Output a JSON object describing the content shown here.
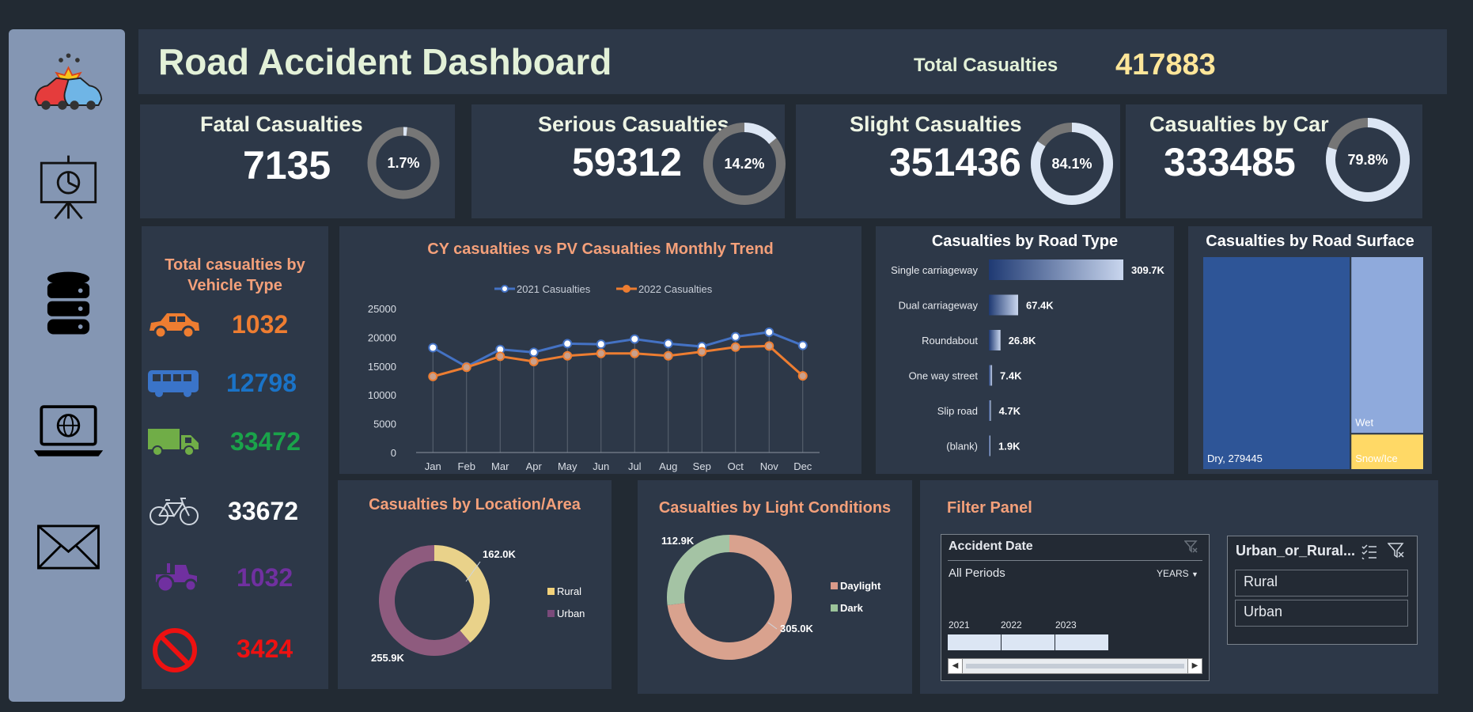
{
  "header": {
    "title": "Road Accident Dashboard",
    "total_label": "Total Casualties",
    "total_value": "417883"
  },
  "kpis": [
    {
      "title": "Fatal Casualties",
      "value": "7135",
      "pct_label": "1.7%",
      "pct": 1.7
    },
    {
      "title": "Serious Casualties",
      "value": "59312",
      "pct_label": "14.2%",
      "pct": 14.2
    },
    {
      "title": "Slight Casualties",
      "value": "351436",
      "pct_label": "84.1%",
      "pct": 84.1
    },
    {
      "title": "Casualties by Car",
      "value": "333485",
      "pct_label": "79.8%",
      "pct": 79.8
    }
  ],
  "sidebar": {
    "icons": [
      "car-crash-icon",
      "presentation-chart-icon",
      "database-icon",
      "laptop-globe-icon",
      "mail-icon"
    ]
  },
  "vehicle": {
    "title_line1": "Total casualties by",
    "title_line2": "Vehicle Type",
    "items": [
      {
        "icon": "car-icon",
        "value": "1032",
        "color": "#ee7d31"
      },
      {
        "icon": "bus-icon",
        "value": "12798",
        "color": "#1a73c7"
      },
      {
        "icon": "truck-icon",
        "value": "33472",
        "color": "#1aa34a"
      },
      {
        "icon": "bicycle-icon",
        "value": "33672",
        "color": "#ffffff"
      },
      {
        "icon": "tractor-icon",
        "value": "1032",
        "color": "#7030a0"
      },
      {
        "icon": "no-entry-icon",
        "value": "3424",
        "color": "#ee1111"
      }
    ]
  },
  "chart_data": [
    {
      "type": "line",
      "title": "CY casualties vs PV Casualties Monthly Trend",
      "categories": [
        "Jan",
        "Feb",
        "Mar",
        "Apr",
        "May",
        "Jun",
        "Jul",
        "Aug",
        "Sep",
        "Oct",
        "Nov",
        "Dec"
      ],
      "series": [
        {
          "name": "2021 Casualties",
          "color": "#4472c4",
          "values": [
            18200,
            14900,
            17900,
            17400,
            18900,
            18800,
            19700,
            18900,
            18400,
            20100,
            20900,
            18600
          ]
        },
        {
          "name": "2022 Casualties",
          "color": "#ed7d31",
          "values": [
            13200,
            14800,
            16700,
            15800,
            16800,
            17200,
            17200,
            16800,
            17500,
            18300,
            18500,
            13300
          ]
        }
      ],
      "ylim": [
        0,
        25000
      ],
      "yticks": [
        "0",
        "5000",
        "10000",
        "15000",
        "20000",
        "25000"
      ],
      "grid": "vertical",
      "legend": "top"
    },
    {
      "type": "bar",
      "orientation": "horizontal",
      "title": "Casualties by Road Type",
      "categories": [
        "Single carriageway",
        "Dual carriageway",
        "Roundabout",
        "One way street",
        "Slip road",
        "(blank)"
      ],
      "values": [
        309.7,
        67.4,
        26.8,
        7.4,
        4.7,
        1.9
      ],
      "labels": [
        "309.7K",
        "67.4K",
        "26.8K",
        "7.4K",
        "4.7K",
        "1.9K"
      ],
      "unit": "K"
    },
    {
      "type": "treemap",
      "title": "Casualties by Road Surface",
      "items": [
        {
          "name": "Dry",
          "label": "Dry, 279445",
          "value": 279445,
          "color": "#2e5597"
        },
        {
          "name": "Wet",
          "label": "Wet",
          "value": 115000,
          "color": "#8faadc"
        },
        {
          "name": "Snow/Ice",
          "label": "Snow/Ice",
          "value": 23438,
          "color": "#ffd966"
        }
      ]
    },
    {
      "type": "pie",
      "title": "Casualties by Location/Area",
      "categories": [
        "Rural",
        "Urban"
      ],
      "values": [
        162.0,
        255.9
      ],
      "labels": [
        "162.0K",
        "255.9K"
      ],
      "colors": [
        "#f3d27a",
        "#7a4a7a"
      ],
      "legend": "right"
    },
    {
      "type": "pie",
      "title": "Casualties by Light Conditions",
      "categories": [
        "Daylight",
        "Dark"
      ],
      "values": [
        305.0,
        112.9
      ],
      "labels": [
        "305.0K",
        "112.9K"
      ],
      "colors": [
        "#d99a8a",
        "#9cc49a"
      ],
      "legend": "right"
    }
  ],
  "filter": {
    "title": "Filter Panel",
    "date_slicer": {
      "header": "Accident Date",
      "period": "All Periods",
      "unit": "YEARS",
      "years": [
        "2021",
        "2022",
        "2023"
      ]
    },
    "area_slicer": {
      "header": "Urban_or_Rural...",
      "options": [
        "Rural",
        "Urban"
      ]
    }
  }
}
